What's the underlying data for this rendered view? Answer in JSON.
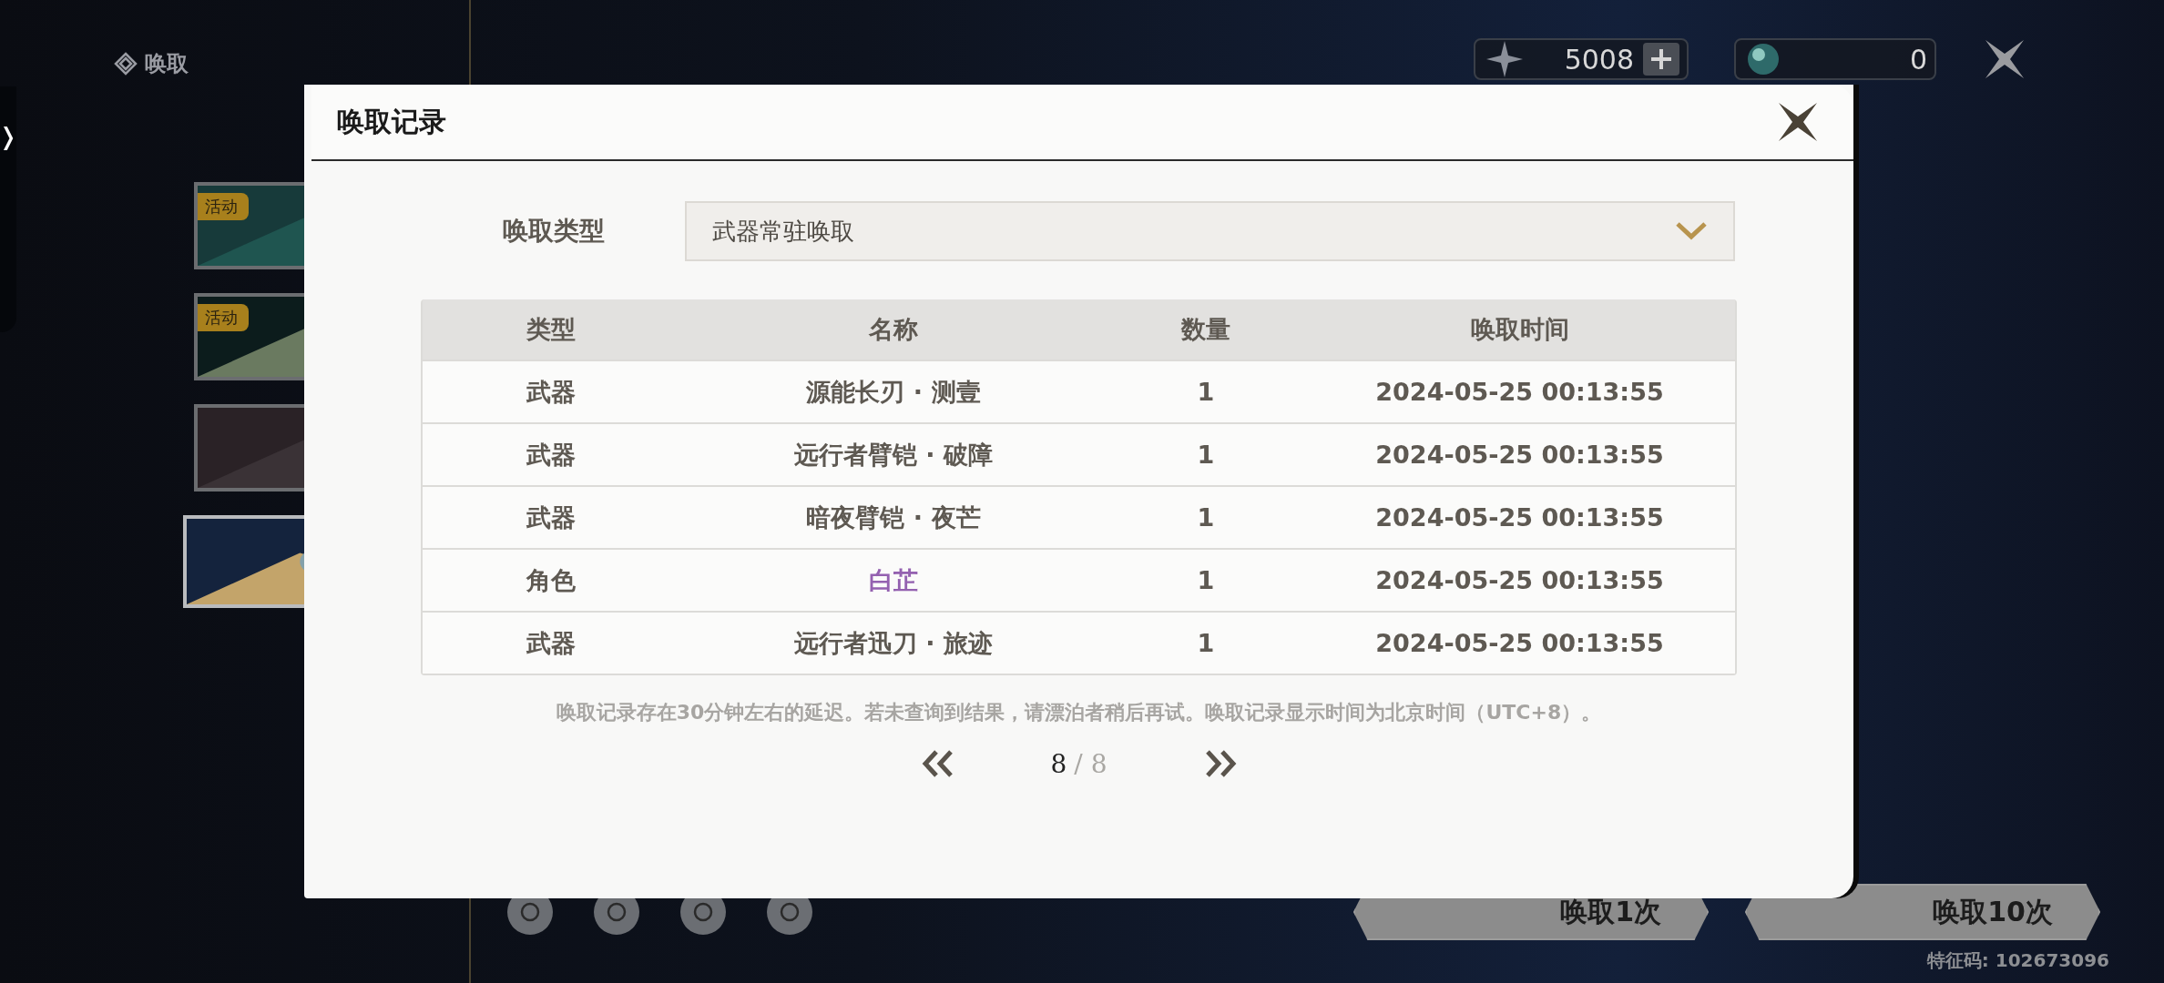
{
  "sidebar": {
    "title": "唤取",
    "handle": "❭",
    "banners": [
      {
        "badge": "活动",
        "selected": false,
        "kind": "dragon"
      },
      {
        "badge": "活动",
        "selected": false,
        "kind": "blade"
      },
      {
        "selected": false,
        "kind": "duo"
      },
      {
        "selected": true,
        "kind": "sword"
      }
    ]
  },
  "currencies": [
    {
      "kind": "star",
      "amount": "5008"
    },
    {
      "kind": "orb",
      "amount": "0"
    }
  ],
  "pull_buttons": [
    {
      "label": "唤取1次"
    },
    {
      "label": "唤取10次"
    }
  ],
  "footer": {
    "code": "特征码: 102673096"
  },
  "dialog": {
    "title": "唤取记录",
    "filter": {
      "label": "唤取类型",
      "value": "武器常驻唤取"
    },
    "table": {
      "columns": [
        "类型",
        "名称",
        "数量",
        "唤取时间"
      ],
      "rows": [
        {
          "cells": [
            "武器",
            "源能长刃 · 测壹",
            "1",
            "2024-05-25 00:13:55"
          ],
          "color": "#5e5952"
        },
        {
          "cells": [
            "武器",
            "远行者臂铠 · 破障",
            "1",
            "2024-05-25 00:13:55"
          ],
          "color": "#5e5952"
        },
        {
          "cells": [
            "武器",
            "暗夜臂铠 · 夜芒",
            "1",
            "2024-05-25 00:13:55"
          ],
          "color": "#5e5952"
        },
        {
          "cells": [
            "角色",
            "白芷",
            "1",
            "2024-05-25 00:13:55"
          ],
          "color": "#9461b0"
        },
        {
          "cells": [
            "武器",
            "远行者迅刀 · 旅迹",
            "1",
            "2024-05-25 00:13:55"
          ],
          "color": "#5e5952"
        }
      ]
    },
    "note": "唤取记录存在30分钟左右的延迟。若未查询到结果，请漂泊者稍后再试。唤取记录显示时间为北京时间（UTC+8）。",
    "pagination": {
      "current": "8",
      "total": "/ 8"
    }
  }
}
